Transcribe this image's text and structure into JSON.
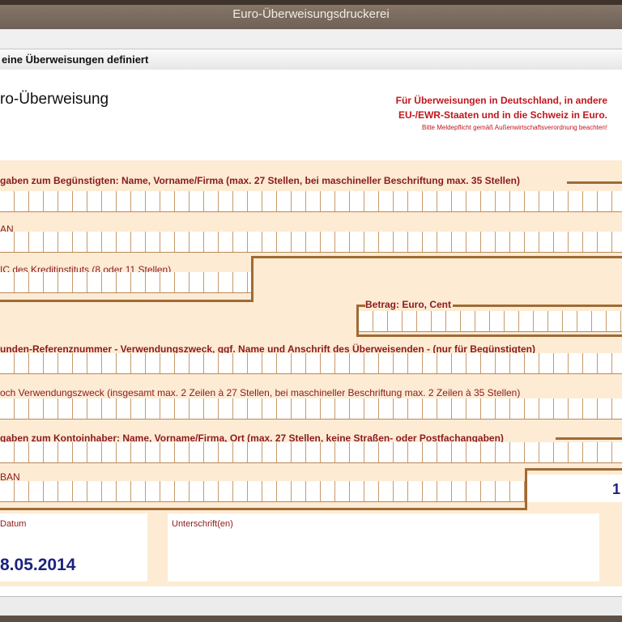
{
  "window": {
    "title": "Euro-Überweisungsdruckerei"
  },
  "status": {
    "text": "eine Überweisungen definiert"
  },
  "form": {
    "heading": "ro-Überweisung",
    "notice_line1": "Für Überweisungen in Deutschland, in andere",
    "notice_line2": "EU-/EWR-Staaten und in die Schweiz in Euro.",
    "notice_small": "Bitte Meldepflicht gemäß Außenwirtschaftsverordnung beachten!",
    "beneficiary_label": "gaben zum Begünstigten: Name, Vorname/Firma (max. 27 Stellen, bei maschineller Beschriftung max. 35 Stellen)",
    "iban_label": "AN",
    "bic_label": "IC des Kreditinstituts (8 oder 11 Stellen)",
    "amount_label": "Betrag: Euro, Cent",
    "reference_label": "unden-Referenznummer - Verwendungszweck, ggf. Name und Anschrift des Überweisenden - (nur für Begünstigten)",
    "purpose_label": "och Verwendungszweck (insgesamt max. 2 Zeilen à 27 Stellen, bei maschineller Beschriftung max. 2 Zeilen à 35 Stellen)",
    "account_holder_label": "gaben zum Kontoinhaber: Name, Vorname/Firma, Ort (max. 27 Stellen, keine Straßen- oder Postfachangaben)",
    "payer_iban_label": "BAN",
    "payer_iban_suffix": "1",
    "date_label": "Datum",
    "date_value": "8.05.2014",
    "signature_label": "Unterschrift(en)"
  }
}
